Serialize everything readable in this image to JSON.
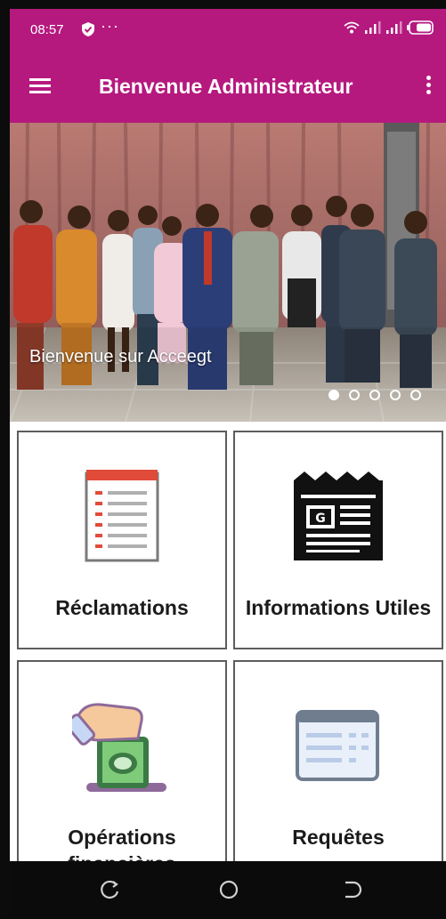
{
  "status_bar": {
    "time": "08:57",
    "more": "···",
    "icons": [
      "shield-check-icon",
      "wifi-icon",
      "signal-icon",
      "signal-icon",
      "battery-icon"
    ]
  },
  "app_bar": {
    "title": "Bienvenue Administrateur",
    "menu_icon": "hamburger-menu-icon",
    "overflow_icon": "more-vert-icon"
  },
  "banner": {
    "caption": "Bienvenue sur Acceegt",
    "slide_count": 5,
    "active_slide": 1
  },
  "tiles": [
    {
      "label": "Réclamations",
      "icon": "checklist-document-icon"
    },
    {
      "label": "Informations Utiles",
      "icon": "newspaper-icon"
    },
    {
      "label": "Opérations financières",
      "icon": "hand-inserting-money-icon"
    },
    {
      "label": "Requêtes",
      "icon": "form-window-icon"
    }
  ],
  "nav_bar": {
    "icons": [
      "recent-apps-icon",
      "home-icon",
      "back-icon"
    ]
  },
  "colors": {
    "brand": "#b5197e",
    "tile_border": "#5d5d5d",
    "nav_background": "#0b0b0b"
  }
}
